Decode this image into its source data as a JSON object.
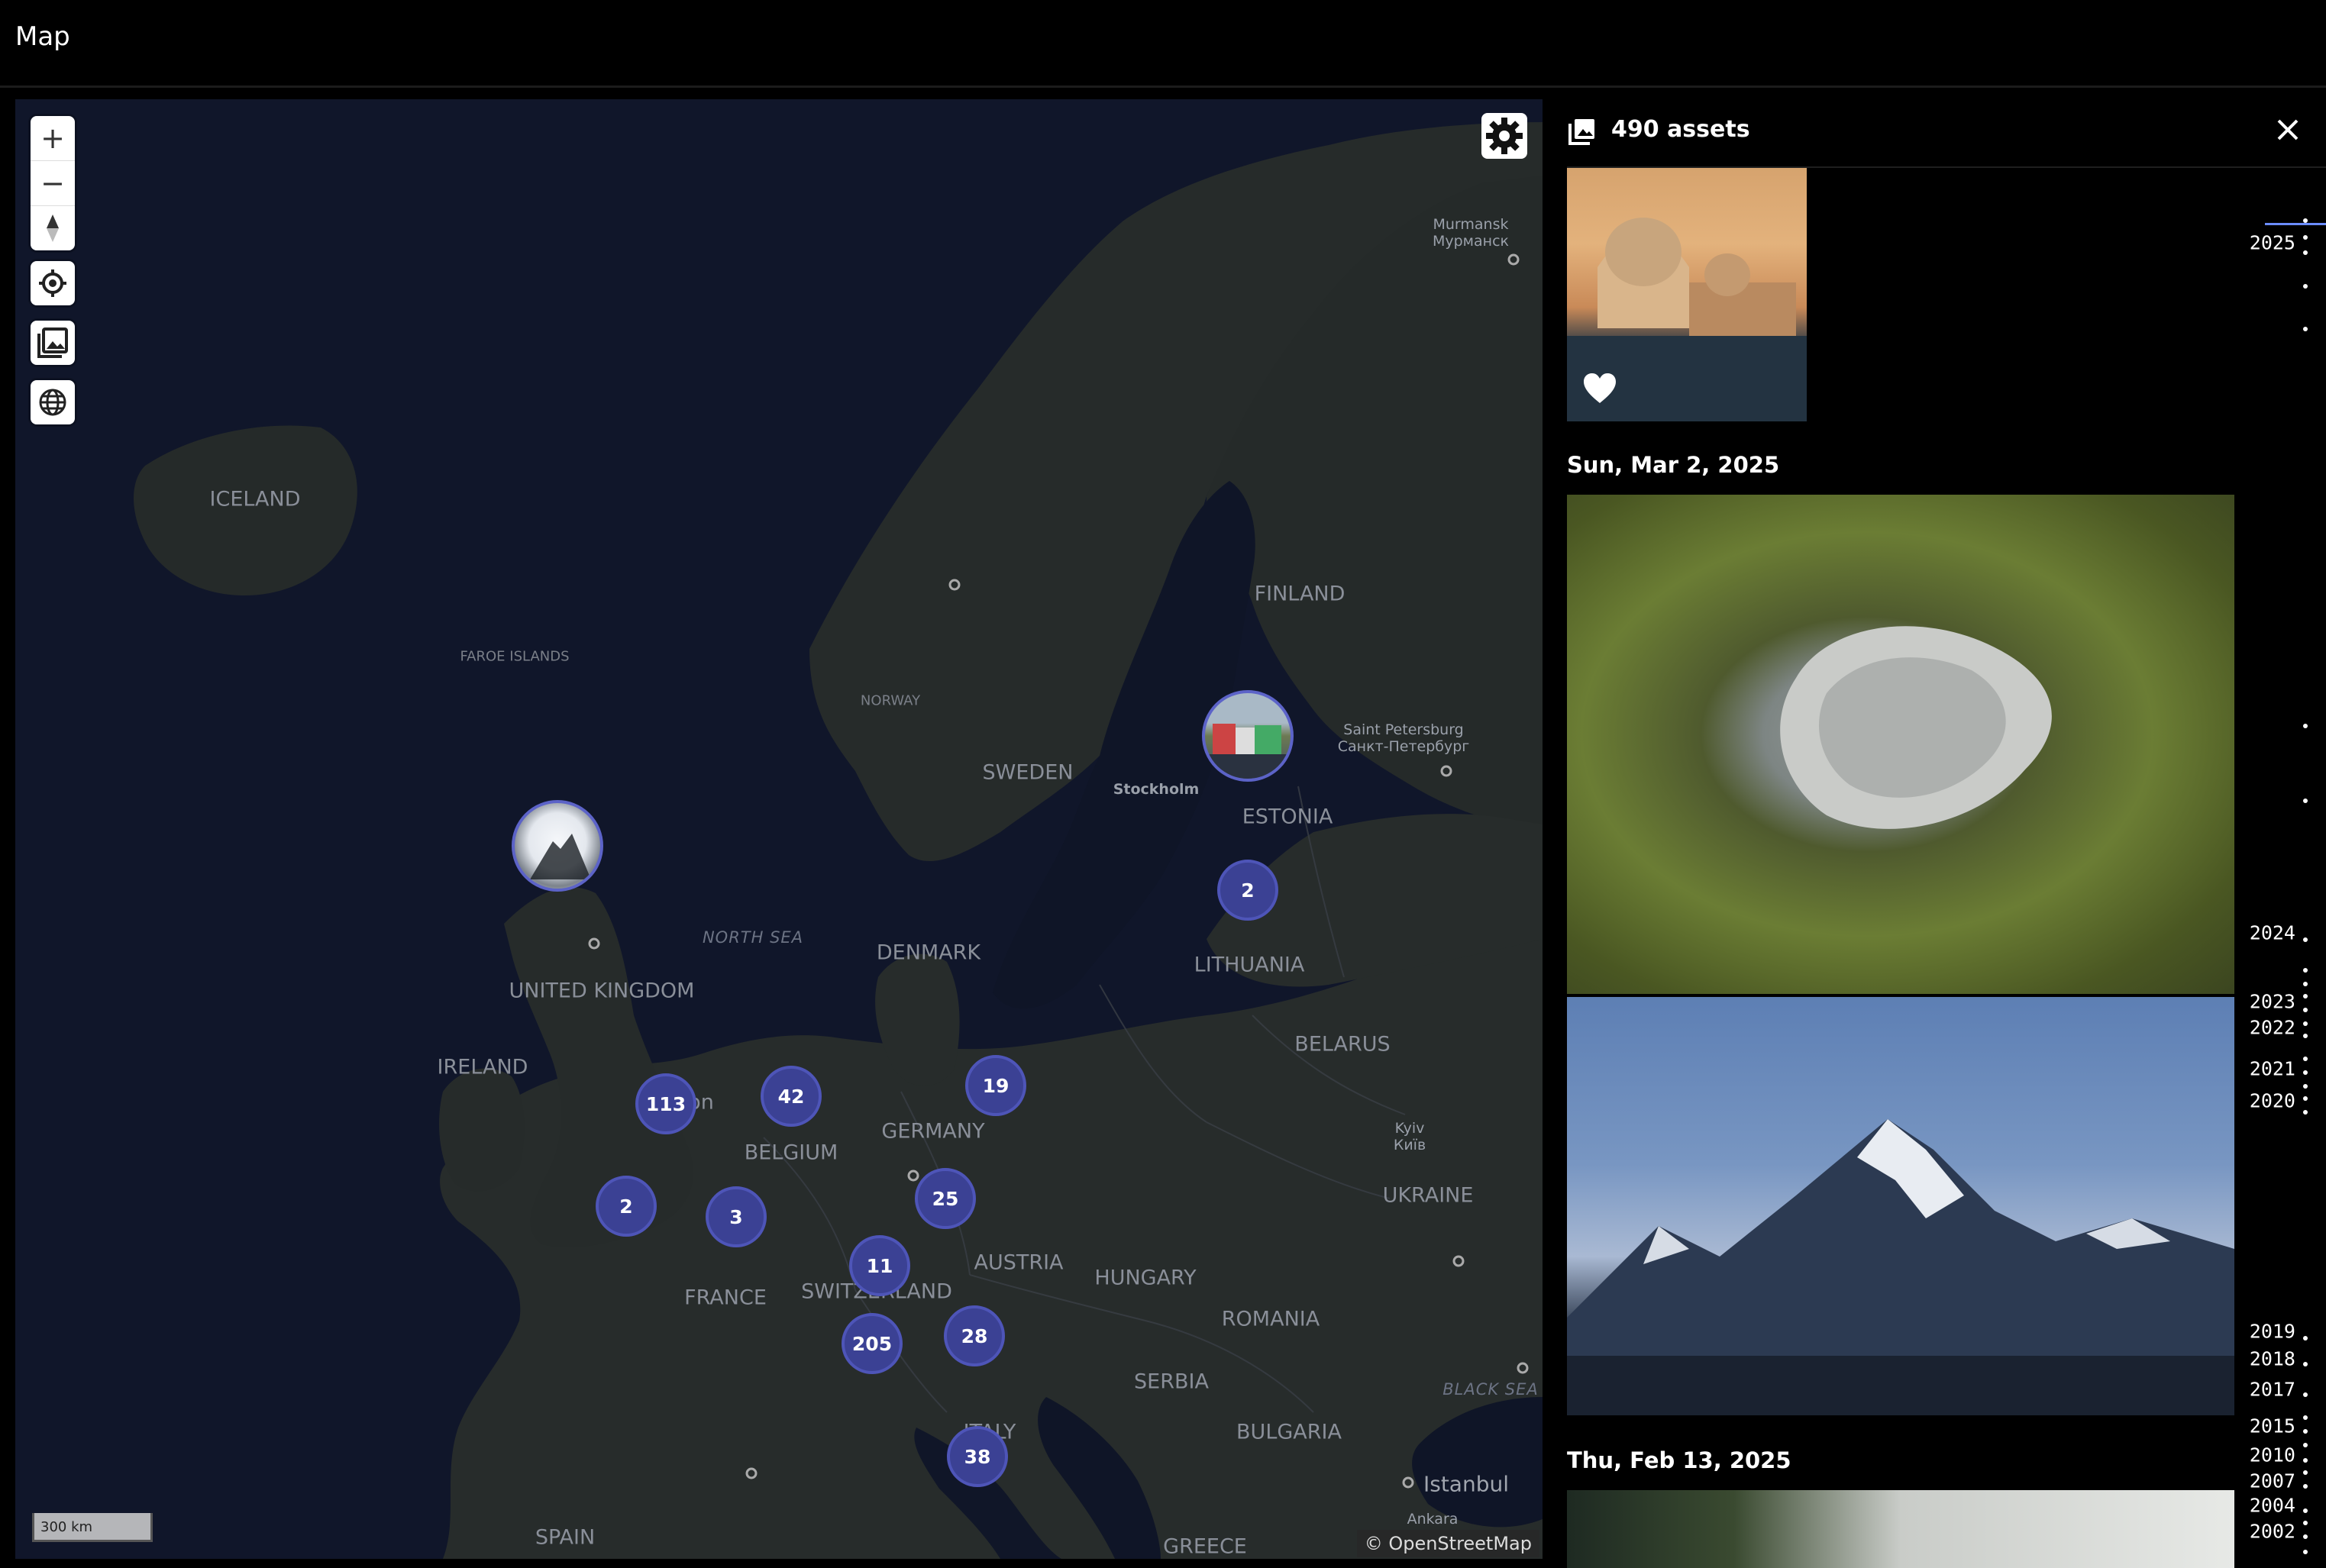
{
  "topbar": {
    "title": "Map"
  },
  "map": {
    "controls": {
      "zoom_in": "+",
      "zoom_out": "−",
      "compass": "▲"
    },
    "labels": {
      "iceland": "ICELAND",
      "faroe": "FAROE ISLANDS",
      "norway": "NORWAY",
      "sweden": "SWEDEN",
      "finland": "FINLAND",
      "estonia": "ESTONIA",
      "lithuania": "LITHUANIA",
      "belarus": "BELARUS",
      "ukraine": "UKRAINE",
      "denmark": "DENMARK",
      "uk": "UNITED KINGDOM",
      "ireland": "IRELAND",
      "belgium": "BELGIUM",
      "germany": "GERMANY",
      "france": "FRANCE",
      "switzerland": "SWITZERLAND",
      "austria": "AUSTRIA",
      "hungary": "HUNGARY",
      "romania": "ROMANIA",
      "serbia": "SERBIA",
      "bulgaria": "BULGARIA",
      "spain": "SPAIN",
      "greece": "GREECE",
      "north_sea": "NORTH SEA",
      "black_sea": "BLACK SEA",
      "stockholm": "Stockholm",
      "murmansk": "Murmansk",
      "murmansk_ru": "Мурманск",
      "spb": "Saint Petersburg",
      "spb_ru": "Санкт-Петербург",
      "kyiv": "Kyiv",
      "kyiv_ua": "Київ",
      "istanbul": "Istanbul",
      "ankara": "Ankara",
      "london_frag": "on",
      "italy_frag": "ITALY"
    },
    "clusters": [
      {
        "id": "c-2-baltic",
        "count": "2"
      },
      {
        "id": "c-113",
        "count": "113"
      },
      {
        "id": "c-42",
        "count": "42"
      },
      {
        "id": "c-19",
        "count": "19"
      },
      {
        "id": "c-2-france",
        "count": "2"
      },
      {
        "id": "c-3",
        "count": "3"
      },
      {
        "id": "c-25",
        "count": "25"
      },
      {
        "id": "c-11",
        "count": "11"
      },
      {
        "id": "c-205",
        "count": "205"
      },
      {
        "id": "c-28",
        "count": "28"
      },
      {
        "id": "c-38",
        "count": "38"
      }
    ],
    "scale": "300 km",
    "attribution": "© OpenStreetMap"
  },
  "panel": {
    "asset_count": "490 assets",
    "groups": [
      {
        "date": "Sun, Mar 2, 2025"
      },
      {
        "date": "Thu, Feb 13, 2025"
      }
    ]
  },
  "scrubber": {
    "years": [
      "2025",
      "2024",
      "2023",
      "2022",
      "2021",
      "2020",
      "2019",
      "2018",
      "2017",
      "2015",
      "2010",
      "2007",
      "2004",
      "2002"
    ]
  }
}
